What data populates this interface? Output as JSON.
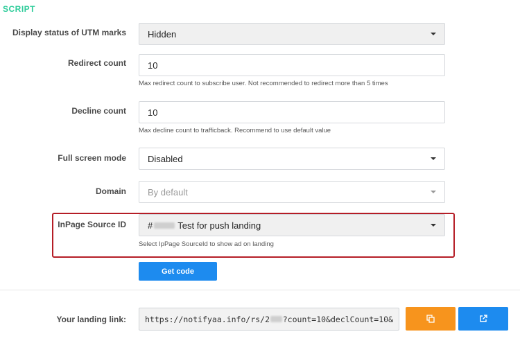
{
  "section": {
    "title": "SCRIPT"
  },
  "utm": {
    "label": "Display status of UTM marks",
    "value": "Hidden"
  },
  "redirect": {
    "label": "Redirect count",
    "value": "10",
    "help": "Max redirect count to subscribe user. Not recommended to redirect more than 5 times"
  },
  "decline": {
    "label": "Decline count",
    "value": "10",
    "help": "Max decline count to trafficback. Recommend to use default value"
  },
  "fullscreen": {
    "label": "Full screen mode",
    "value": "Disabled"
  },
  "domain": {
    "label": "Domain",
    "value": "By default"
  },
  "inpage": {
    "label": "InPage Source ID",
    "value_prefix": "#",
    "value_text": "Test for push landing",
    "help": "Select IpPage SourceId to show ad on landing"
  },
  "actions": {
    "get_code": "Get code"
  },
  "landing": {
    "label": "Your landing link:",
    "url_start": "https://notifyaa.info/rs/2",
    "url_end": "?count=10&declCount=10&"
  },
  "icons": {
    "copy": "copy-icon",
    "open": "external-link-icon"
  },
  "colors": {
    "accent_green": "#2ecc9a",
    "primary_blue": "#1d8bef",
    "orange": "#f7941d",
    "highlight_red": "#b51d26"
  }
}
